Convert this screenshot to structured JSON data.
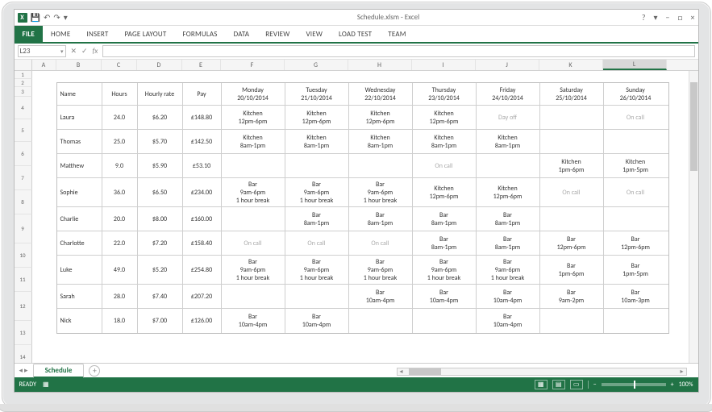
{
  "window": {
    "title": "Schedule.xlsm - Excel",
    "help_icon": "?",
    "ribbon_collapse_icon": "▾",
    "minimize_icon": "−",
    "maximize_icon": "□",
    "close_icon": "×",
    "app_abbrev": "X"
  },
  "qat": {
    "save": "💾",
    "undo": "↶",
    "redo": "↷",
    "more": "▾"
  },
  "ribbon": {
    "tabs": [
      "FILE",
      "HOME",
      "INSERT",
      "PAGE LAYOUT",
      "FORMULAS",
      "DATA",
      "REVIEW",
      "VIEW",
      "LOAD TEST",
      "TEAM"
    ]
  },
  "namebox": {
    "value": "L23",
    "dropdown": "▾"
  },
  "fx": {
    "cancel": "✕",
    "enter": "✓",
    "fx": "fx",
    "formula": ""
  },
  "columns": [
    "A",
    "B",
    "C",
    "D",
    "E",
    "F",
    "G",
    "H",
    "I",
    "J",
    "K",
    "L"
  ],
  "active_column": "L",
  "row_numbers": [
    1,
    2,
    3,
    4,
    5,
    6,
    7,
    8,
    9,
    10,
    11,
    12,
    13,
    14
  ],
  "schedule": {
    "headers": {
      "name": "Name",
      "hours": "Hours",
      "rate": "Hourly rate",
      "pay": "Pay",
      "days": [
        {
          "dow": "Monday",
          "date": "20/10/2014"
        },
        {
          "dow": "Tuesday",
          "date": "21/10/2014"
        },
        {
          "dow": "Wednesday",
          "date": "22/10/2014"
        },
        {
          "dow": "Thursday",
          "date": "23/10/2014"
        },
        {
          "dow": "Friday",
          "date": "24/10/2014"
        },
        {
          "dow": "Saturday",
          "date": "25/10/2014"
        },
        {
          "dow": "Sunday",
          "date": "26/10/2014"
        }
      ]
    },
    "rows": [
      {
        "name": "Laura",
        "hours": "24.0",
        "rate": "$6.20",
        "pay": "£148.80",
        "shifts": [
          [
            "Kitchen",
            "12pm-6pm"
          ],
          [
            "Kitchen",
            "12pm-6pm"
          ],
          [
            "Kitchen",
            "12pm-6pm"
          ],
          [
            "Kitchen",
            "12pm-6pm"
          ],
          [
            "Day off",
            "",
            true
          ],
          [
            "",
            ""
          ],
          [
            "On call",
            "",
            true
          ]
        ]
      },
      {
        "name": "Thomas",
        "hours": "25.0",
        "rate": "$5.70",
        "pay": "£142.50",
        "shifts": [
          [
            "Kitchen",
            "8am-1pm"
          ],
          [
            "Kitchen",
            "8am-1pm"
          ],
          [
            "Kitchen",
            "8am-1pm"
          ],
          [
            "Kitchen",
            "8am-1pm"
          ],
          [
            "Kitchen",
            "8am-1pm"
          ],
          [
            "",
            ""
          ],
          [
            "",
            ""
          ]
        ]
      },
      {
        "name": "Matthew",
        "hours": "9.0",
        "rate": "$5.90",
        "pay": "£53.10",
        "shifts": [
          [
            "",
            ""
          ],
          [
            "",
            ""
          ],
          [
            "",
            ""
          ],
          [
            "On call",
            "",
            true
          ],
          [
            "",
            ""
          ],
          [
            "Kitchen",
            "1pm-6pm"
          ],
          [
            "Kitchen",
            "1pm-5pm"
          ]
        ]
      },
      {
        "name": "Sophie",
        "hours": "36.0",
        "rate": "$6.50",
        "pay": "£234.00",
        "shifts": [
          [
            "Bar",
            "9am-6pm",
            "1 hour break"
          ],
          [
            "Bar",
            "9am-6pm",
            "1 hour break"
          ],
          [
            "Bar",
            "9am-6pm",
            "1 hour break"
          ],
          [
            "Kitchen",
            "12pm-6pm"
          ],
          [
            "Kitchen",
            "12pm-6pm"
          ],
          [
            "On call",
            "",
            true
          ],
          [
            "On call",
            "",
            true
          ]
        ]
      },
      {
        "name": "Charlie",
        "hours": "20.0",
        "rate": "$8.00",
        "pay": "£160.00",
        "shifts": [
          [
            "",
            ""
          ],
          [
            "Bar",
            "8am-1pm"
          ],
          [
            "Bar",
            "8am-1pm"
          ],
          [
            "Bar",
            "8am-1pm"
          ],
          [
            "Bar",
            "8am-1pm"
          ],
          [
            "",
            ""
          ],
          [
            "",
            ""
          ]
        ]
      },
      {
        "name": "Charlotte",
        "hours": "22.0",
        "rate": "$7.20",
        "pay": "£158.40",
        "shifts": [
          [
            "On call",
            "",
            true
          ],
          [
            "On call",
            "",
            true
          ],
          [
            "On call",
            "",
            true
          ],
          [
            "Bar",
            "8am-1pm"
          ],
          [
            "Bar",
            "8am-1pm"
          ],
          [
            "Bar",
            "12pm-6pm"
          ],
          [
            "Bar",
            "12pm-6pm"
          ]
        ]
      },
      {
        "name": "Luke",
        "hours": "49.0",
        "rate": "$5.20",
        "pay": "£254.80",
        "shifts": [
          [
            "Bar",
            "9am-6pm",
            "1 hour break"
          ],
          [
            "Bar",
            "9am-6pm",
            "1 hour break"
          ],
          [
            "Bar",
            "9am-6pm",
            "1 hour break"
          ],
          [
            "Bar",
            "9am-6pm",
            "1 hour break"
          ],
          [
            "Bar",
            "9am-6pm",
            "1 hour break"
          ],
          [
            "Bar",
            "1pm-6pm"
          ],
          [
            "Bar",
            "1pm-5pm"
          ]
        ]
      },
      {
        "name": "Sarah",
        "hours": "28.0",
        "rate": "$7.40",
        "pay": "£207.20",
        "shifts": [
          [
            "",
            ""
          ],
          [
            "",
            ""
          ],
          [
            "Bar",
            "10am-4pm"
          ],
          [
            "Bar",
            "10am-4pm"
          ],
          [
            "Bar",
            "10am-4pm"
          ],
          [
            "Bar",
            "9am-2pm"
          ],
          [
            "Bar",
            "10am-3pm"
          ]
        ]
      },
      {
        "name": "Nick",
        "hours": "18.0",
        "rate": "$7.00",
        "pay": "£126.00",
        "shifts": [
          [
            "Bar",
            "10am-4pm"
          ],
          [
            "Bar",
            "10am-4pm"
          ],
          [
            "",
            ""
          ],
          [
            "",
            ""
          ],
          [
            "Bar",
            "10am-4pm"
          ],
          [
            "",
            ""
          ],
          [
            "",
            ""
          ]
        ]
      }
    ]
  },
  "sheettabs": {
    "nav_prev": "◂",
    "nav_next": "▸",
    "name": "Schedule",
    "add": "+"
  },
  "statusbar": {
    "ready": "READY",
    "macro": "▦",
    "zoom_minus": "−",
    "zoom_plus": "+",
    "zoom_text": "100%"
  }
}
